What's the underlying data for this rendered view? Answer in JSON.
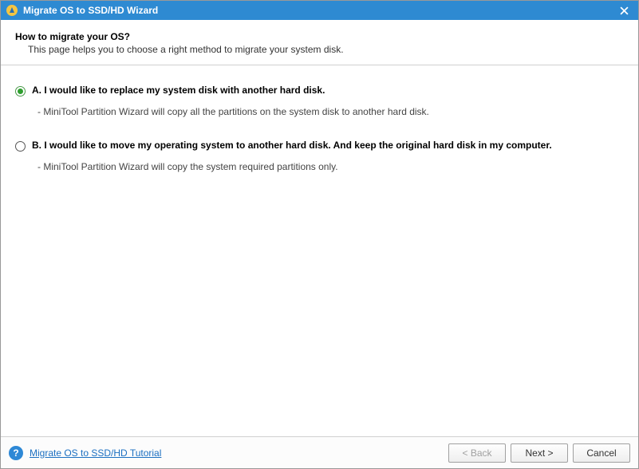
{
  "titlebar": {
    "title": "Migrate OS to SSD/HD Wizard"
  },
  "header": {
    "heading": "How to migrate your OS?",
    "subheading": "This page helps you to choose a right method to migrate your system disk."
  },
  "options": {
    "a": {
      "label": "A. I would like to replace my system disk with another hard disk.",
      "description": "- MiniTool Partition Wizard will copy all the partitions on the system disk to another hard disk.",
      "selected": true
    },
    "b": {
      "label": "B. I would like to move my operating system to another hard disk. And keep the original hard disk in my computer.",
      "description": "- MiniTool Partition Wizard will copy the system required partitions only.",
      "selected": false
    }
  },
  "footer": {
    "tutorial_link": "Migrate OS to SSD/HD Tutorial",
    "back_label": "< Back",
    "next_label": "Next >",
    "cancel_label": "Cancel"
  }
}
